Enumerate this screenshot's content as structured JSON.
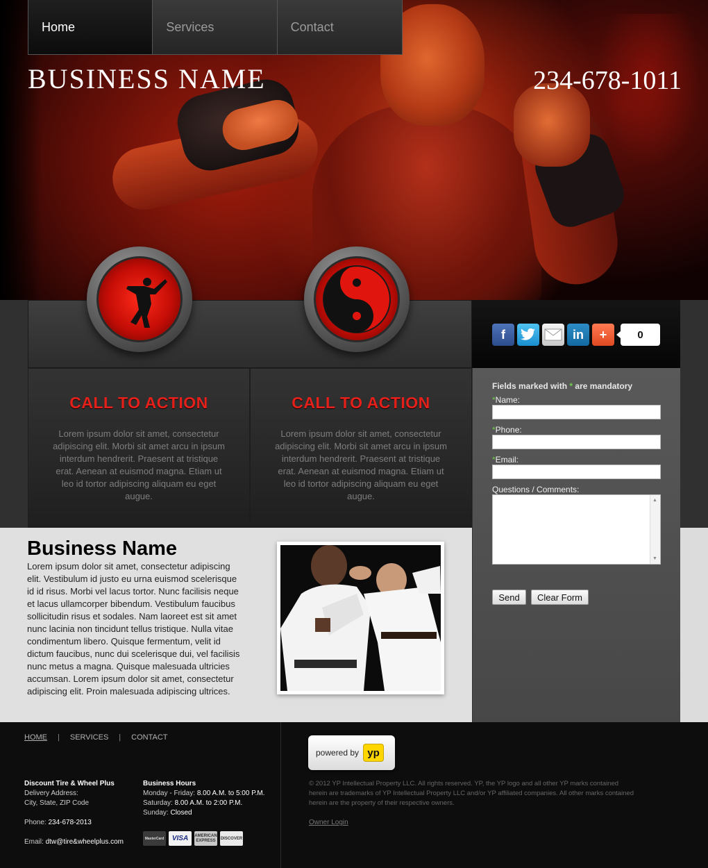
{
  "nav": {
    "items": [
      {
        "label": "Home",
        "active": true
      },
      {
        "label": "Services",
        "active": false
      },
      {
        "label": "Contact",
        "active": false
      }
    ]
  },
  "header": {
    "business_name": "BUSINESS NAME",
    "phone": "234-678-1011"
  },
  "social": {
    "icons": [
      "facebook-icon",
      "twitter-icon",
      "email-icon",
      "linkedin-icon",
      "plus-share-icon"
    ],
    "count": "0"
  },
  "cta": [
    {
      "title": "CALL TO ACTION",
      "text": "Lorem ipsum dolor sit amet, consectetur adipiscing elit. Morbi sit amet arcu in ipsum interdum hendrerit. Praesent at tristique erat. Aenean at euismod magna. Etiam ut leo id tortor adipiscing aliquam eu eget augue."
    },
    {
      "title": "CALL TO ACTION",
      "text": "Lorem ipsum dolor sit amet, consectetur adipiscing elit. Morbi sit amet arcu in ipsum interdum hendrerit. Praesent at tristique erat. Aenean at euismod magna. Etiam ut leo id tortor adipiscing aliquam eu eget augue."
    }
  ],
  "form": {
    "note_prefix": "Fields marked with",
    "note_star": "*",
    "note_suffix": "are mandatory",
    "required_mark": "*",
    "name_label": "Name:",
    "phone_label": "Phone:",
    "email_label": "Email:",
    "comments_label": "Questions / Comments:",
    "send_label": "Send",
    "clear_label": "Clear Form"
  },
  "content": {
    "heading": "Business Name",
    "text": "Lorem ipsum dolor sit amet, consectetur adipiscing elit. Vestibulum id justo eu urna euismod scelerisque id id risus. Morbi vel lacus tortor. Nunc facilisis neque et lacus ullamcorper bibendum. Vestibulum faucibus sollicitudin risus et sodales. Nam laoreet est sit amet nunc lacinia non tincidunt tellus tristique. Nulla vitae condimentum libero. Quisque fermentum, velit id dictum faucibus, nunc dui scelerisque dui, vel facilisis nunc metus a magna. Quisque malesuada ultricies accumsan. Lorem ipsum dolor sit amet, consectetur adipiscing elit. Proin malesuada adipiscing ultrices."
  },
  "footer": {
    "nav": [
      "HOME",
      "SERVICES",
      "CONTACT"
    ],
    "separator": "|",
    "company": "Discount Tire & Wheel Plus",
    "delivery_label": "Delivery Address:",
    "address": "City, State, ZIP Code",
    "phone_label": "Phone:",
    "phone": "234-678-2013",
    "email_label": "Email:",
    "email": "dtw@tire&wheelplus.com",
    "hours_title": "Business Hours",
    "hours": [
      {
        "day": "Monday - Friday:",
        "time": "8.00 A.M. to 5:00 P.M."
      },
      {
        "day": "Saturday:",
        "time": "8.00 A.M. to 2:00 P.M."
      },
      {
        "day": "Sunday:",
        "time": "Closed"
      }
    ],
    "cards": [
      "MasterCard",
      "VISA",
      "AMERICAN EXPRESS",
      "DISCOVER"
    ],
    "powered_by": "powered by",
    "yp_logo": "yp",
    "legal": "© 2012 YP Intellectual Property LLC. All rights reserved. YP, the YP logo and all other YP marks contained herein are trademarks of YP Intellectual Property LLC and/or YP affiliated companies. All other marks contained herein are the property of their respective owners.",
    "owner_login": "Owner Login"
  }
}
